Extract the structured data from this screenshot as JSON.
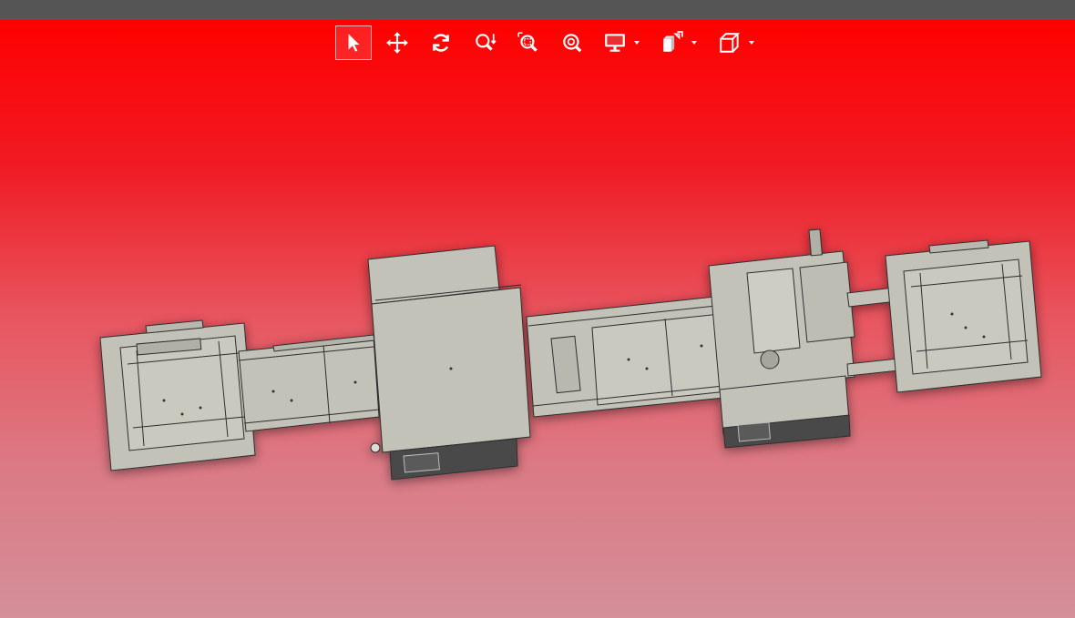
{
  "viewer": {
    "toolbar": {
      "tools": [
        {
          "id": "select",
          "icon": "cursor-icon",
          "active": true
        },
        {
          "id": "pan",
          "icon": "pan-icon",
          "active": false
        },
        {
          "id": "rotate",
          "icon": "rotate-icon",
          "active": false
        },
        {
          "id": "zoom",
          "icon": "zoom-icon",
          "active": false
        },
        {
          "id": "zoom-window",
          "icon": "zoom-window-icon",
          "active": false
        },
        {
          "id": "zoom-fit",
          "icon": "zoom-fit-icon",
          "active": false
        },
        {
          "id": "display-mode",
          "icon": "monitor-icon",
          "has_dropdown": true
        },
        {
          "id": "explode",
          "icon": "explode-icon",
          "has_dropdown": true
        },
        {
          "id": "view-cube",
          "icon": "cube-icon",
          "has_dropdown": true
        }
      ]
    },
    "colors": {
      "topbar": "#555555",
      "background_top": "#ff0000",
      "background_bottom": "#d48f99",
      "model_fill": "#c2c2b8",
      "model_dark": "#3f3f3f",
      "icon": "#ffffff"
    }
  }
}
